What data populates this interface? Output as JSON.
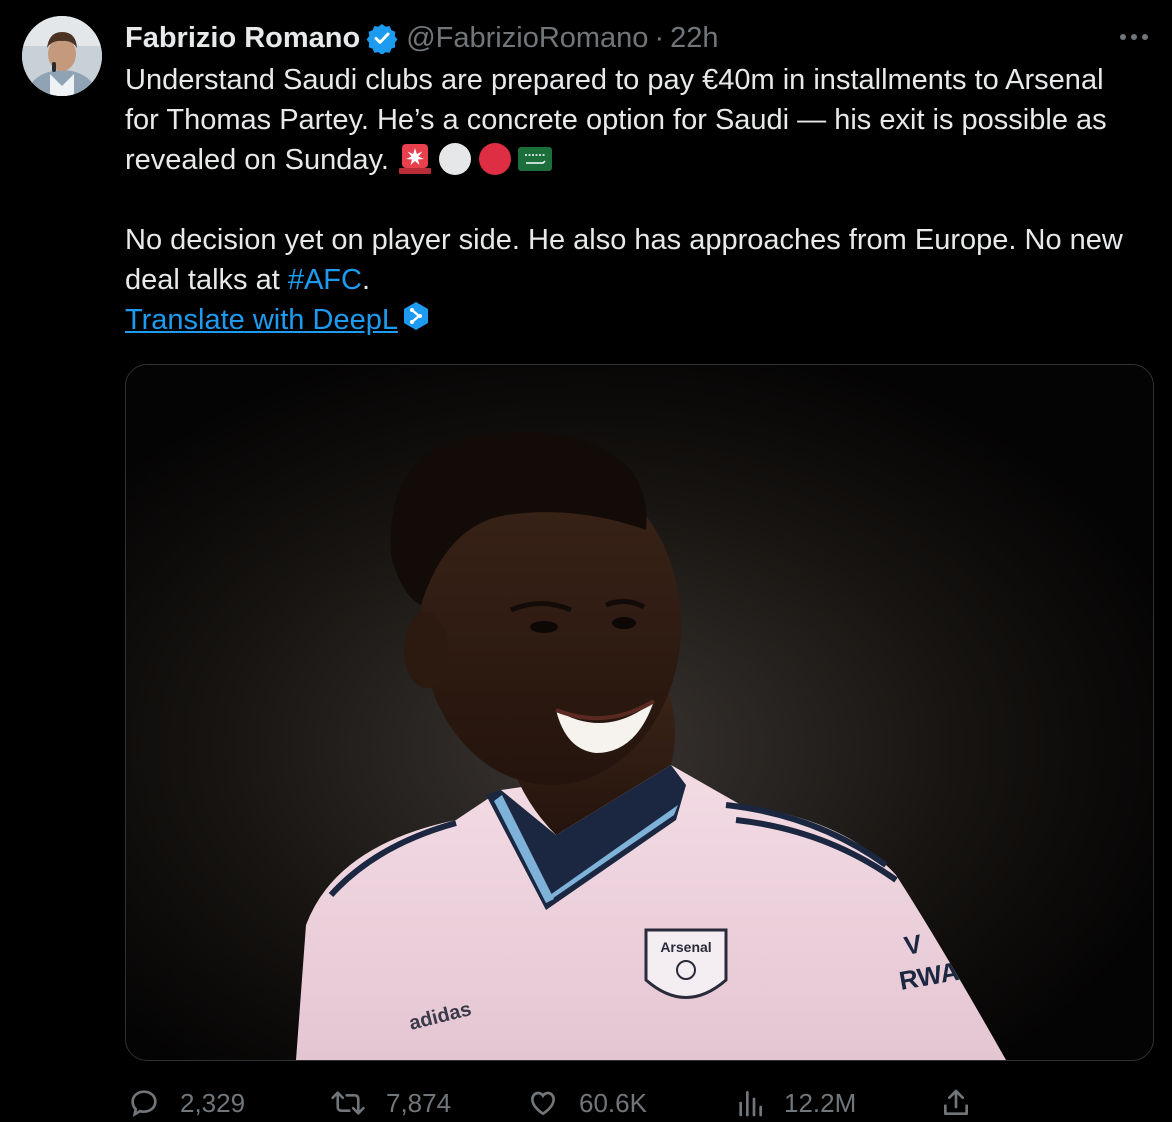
{
  "author": {
    "display_name": "Fabrizio Romano",
    "handle": "@FabrizioRomano",
    "separator": "·",
    "time": "22h",
    "verified": true
  },
  "tweet": {
    "line1_text": "Understand Saudi clubs are prepared to pay €40m in installments to Arsenal for Thomas Partey. He’s a concrete option for Saudi — his exit is possible as revealed on Sunday.",
    "emojis": [
      "siren-emoji",
      "white-circle-emoji",
      "red-circle-emoji",
      "saudi-flag-emoji"
    ],
    "line2_text": "No decision yet on player side. He also has approaches from Europe. No new deal talks at ",
    "hashtag": "#AFC",
    "line2_end": ".",
    "translate_label": "Translate with DeepL"
  },
  "media": {
    "crest_text": "Arsenal",
    "sponsor_text": "V\nRWA",
    "kit_brand_text": "adidas"
  },
  "actions": {
    "replies": "2,329",
    "retweets": "7,874",
    "likes": "60.6K",
    "views": "12.2M"
  },
  "colors": {
    "background": "#000000",
    "text_primary": "#e7e9ea",
    "text_secondary": "#71767b",
    "accent": "#1d9bf0",
    "border": "#2f3336"
  }
}
